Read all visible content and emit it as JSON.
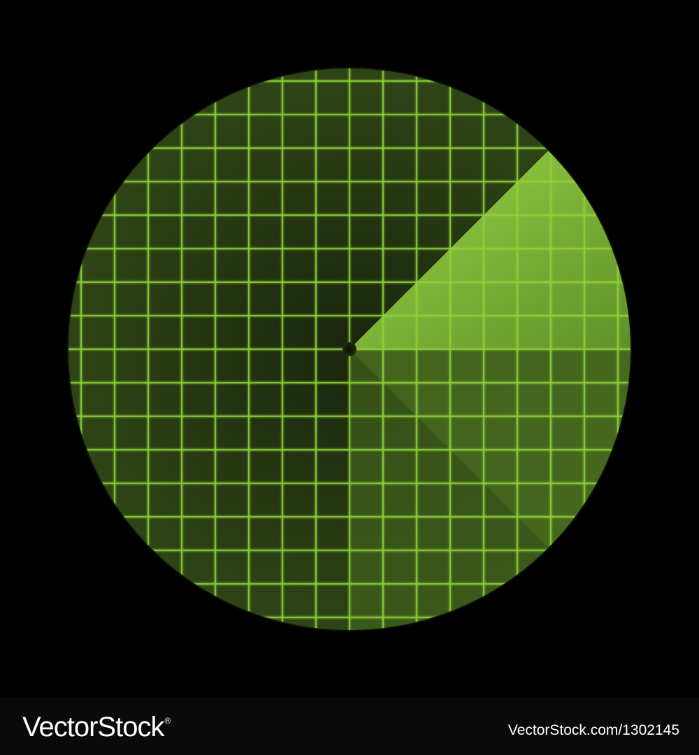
{
  "radar": {
    "sweep_start_angle_deg": -45,
    "sweep_end_angle_deg": 0,
    "colors": {
      "background": "#000000",
      "scope_dark": "#1f2e0f",
      "scope_mid": "#334d18",
      "sweep_bright": "#8fcb3c",
      "grid_line": "#8fd13a",
      "grid_glow": "#d4ff80",
      "center_dot": "#101a08"
    }
  },
  "footer": {
    "logo_text": "VectorStock",
    "logo_mark": "®",
    "image_id_text": "VectorStock.com/1302145"
  }
}
